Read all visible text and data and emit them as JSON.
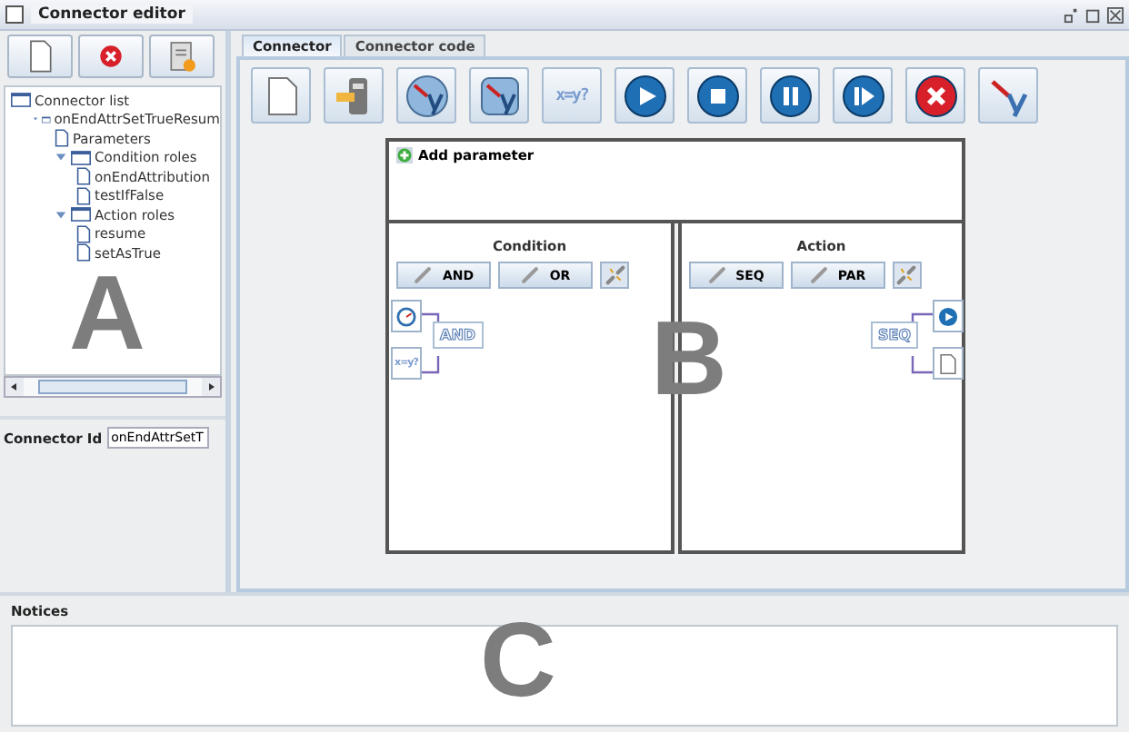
{
  "window": {
    "title": "Connector editor"
  },
  "left_toolbar": [
    {
      "kind": "new"
    },
    {
      "kind": "delete"
    },
    {
      "kind": "export"
    }
  ],
  "tree": [
    {
      "label": "Connector list",
      "kind": "folder",
      "children": [
        {
          "label": "onEndAttrSetTrueResum",
          "kind": "folder",
          "expanded": true,
          "children": [
            {
              "label": "Parameters",
              "kind": "doc"
            },
            {
              "label": "Condition roles",
              "kind": "folder",
              "expanded": true,
              "children": [
                {
                  "label": "onEndAttribution",
                  "kind": "doc"
                },
                {
                  "label": "testIfFalse",
                  "kind": "doc"
                }
              ]
            },
            {
              "label": "Action roles",
              "kind": "folder",
              "expanded": true,
              "children": [
                {
                  "label": "resume",
                  "kind": "doc"
                },
                {
                  "label": "setAsTrue",
                  "kind": "doc"
                }
              ]
            }
          ]
        }
      ]
    }
  ],
  "connector_id": {
    "label": "Connector Id",
    "value": "onEndAttrSetT"
  },
  "tabs": [
    {
      "label": "Connector",
      "selected": true
    },
    {
      "label": "Connector code",
      "selected": false
    }
  ],
  "toolbar": [
    {
      "kind": "new"
    },
    {
      "kind": "remote"
    },
    {
      "kind": "xy-round"
    },
    {
      "kind": "xy-square"
    },
    {
      "kind": "text",
      "label": "x=y?"
    },
    {
      "kind": "play"
    },
    {
      "kind": "stop"
    },
    {
      "kind": "pause"
    },
    {
      "kind": "step"
    },
    {
      "kind": "cancel"
    },
    {
      "kind": "xy"
    }
  ],
  "parameters": {
    "add_button": "Add parameter"
  },
  "condition": {
    "title": "Condition",
    "buttons": [
      "AND",
      "OR"
    ],
    "node": "AND",
    "inputs": [
      {
        "kind": "clock"
      },
      {
        "kind": "text",
        "label": "x=y?"
      }
    ]
  },
  "action": {
    "title": "Action",
    "buttons": [
      "SEQ",
      "PAR"
    ],
    "node": "SEQ",
    "outputs": [
      {
        "kind": "play"
      },
      {
        "kind": "doc"
      }
    ]
  },
  "notices": {
    "label": "Notices"
  },
  "overlay_letters": [
    "A",
    "B",
    "C"
  ]
}
